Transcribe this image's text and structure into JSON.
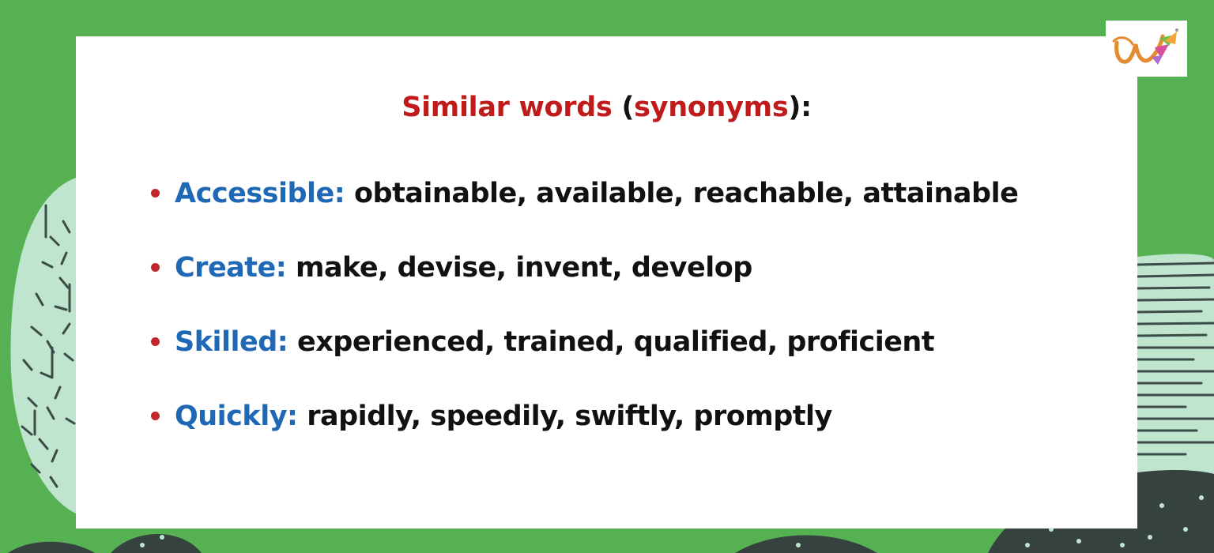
{
  "title": {
    "part1": "Similar words",
    "open_paren": "(",
    "part2": "synonyms",
    "close": "):"
  },
  "items": [
    {
      "term": "Accessible:",
      "synonyms": "obtainable, available, reachable, attainable"
    },
    {
      "term": "Create:",
      "synonyms": "make, devise, invent, develop"
    },
    {
      "term": "Skilled:",
      "synonyms": "experienced, trained, qualified, proficient"
    },
    {
      "term": "Quickly:",
      "synonyms": "rapidly, speedily, swiftly, promptly"
    }
  ],
  "logo": {
    "icon": "w-logo-icon"
  },
  "colors": {
    "background": "#56b152",
    "title_red": "#bf1b1b",
    "term_blue": "#1f68b5",
    "bullet_red": "#c3272b"
  }
}
